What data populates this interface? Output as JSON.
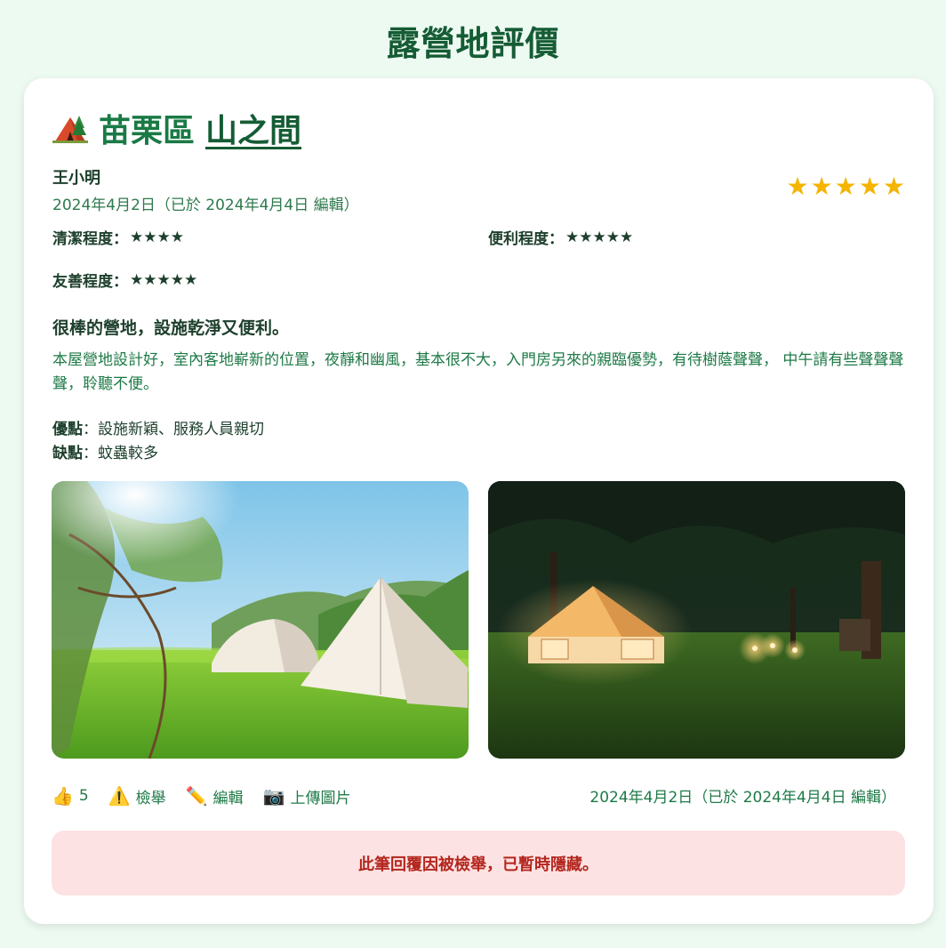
{
  "page": {
    "title": "露營地評價"
  },
  "camp": {
    "region": "苗栗區",
    "name": "山之間",
    "icon": "tent-icon"
  },
  "review": {
    "reviewer": "王小明",
    "date": "2024年4月2日（已於 2024年4月4日 編輯）",
    "overall_rating": 5,
    "overall_stars": "★★★★★",
    "ratings": [
      {
        "label": "清潔程度：",
        "stars": "★★★★",
        "value": 4
      },
      {
        "label": "便利程度：",
        "stars": "★★★★★",
        "value": 5
      },
      {
        "label": "友善程度：",
        "stars": "★★★★★",
        "value": 5
      }
    ],
    "heading": "很棒的營地，設施乾淨又便利。",
    "body": "本屋營地設計好，室內客地嶄新的位置，夜靜和幽風，基本很不大，入門房另來的親臨優勢，有待樹蔭聲聲， 中午請有些聲聲聲聲，聆聽不便。",
    "pros_label": "優點",
    "pros_value": "：設施新穎、服務人員親切",
    "cons_label": "缺點",
    "cons_value": "：蚊蟲較多"
  },
  "photos": [
    {
      "icon": "daytime-tents-photo"
    },
    {
      "icon": "night-tent-photo"
    }
  ],
  "actions": {
    "like_icon": "thumbs-up-icon",
    "like_count": "5",
    "report_label": "檢舉",
    "edit_label": "編輯",
    "upload_label": "上傳圖片",
    "date": "2024年4月2日（已於 2024年4月4日 編輯）"
  },
  "notice": {
    "text": "此筆回覆因被檢舉，已暫時隱藏。"
  },
  "colors": {
    "background": "#edfaf1",
    "title_green": "#155c35",
    "accent_green": "#1e7a47",
    "star_gold": "#f4b400",
    "notice_bg": "#fde2e3",
    "notice_text": "#b3261e"
  }
}
